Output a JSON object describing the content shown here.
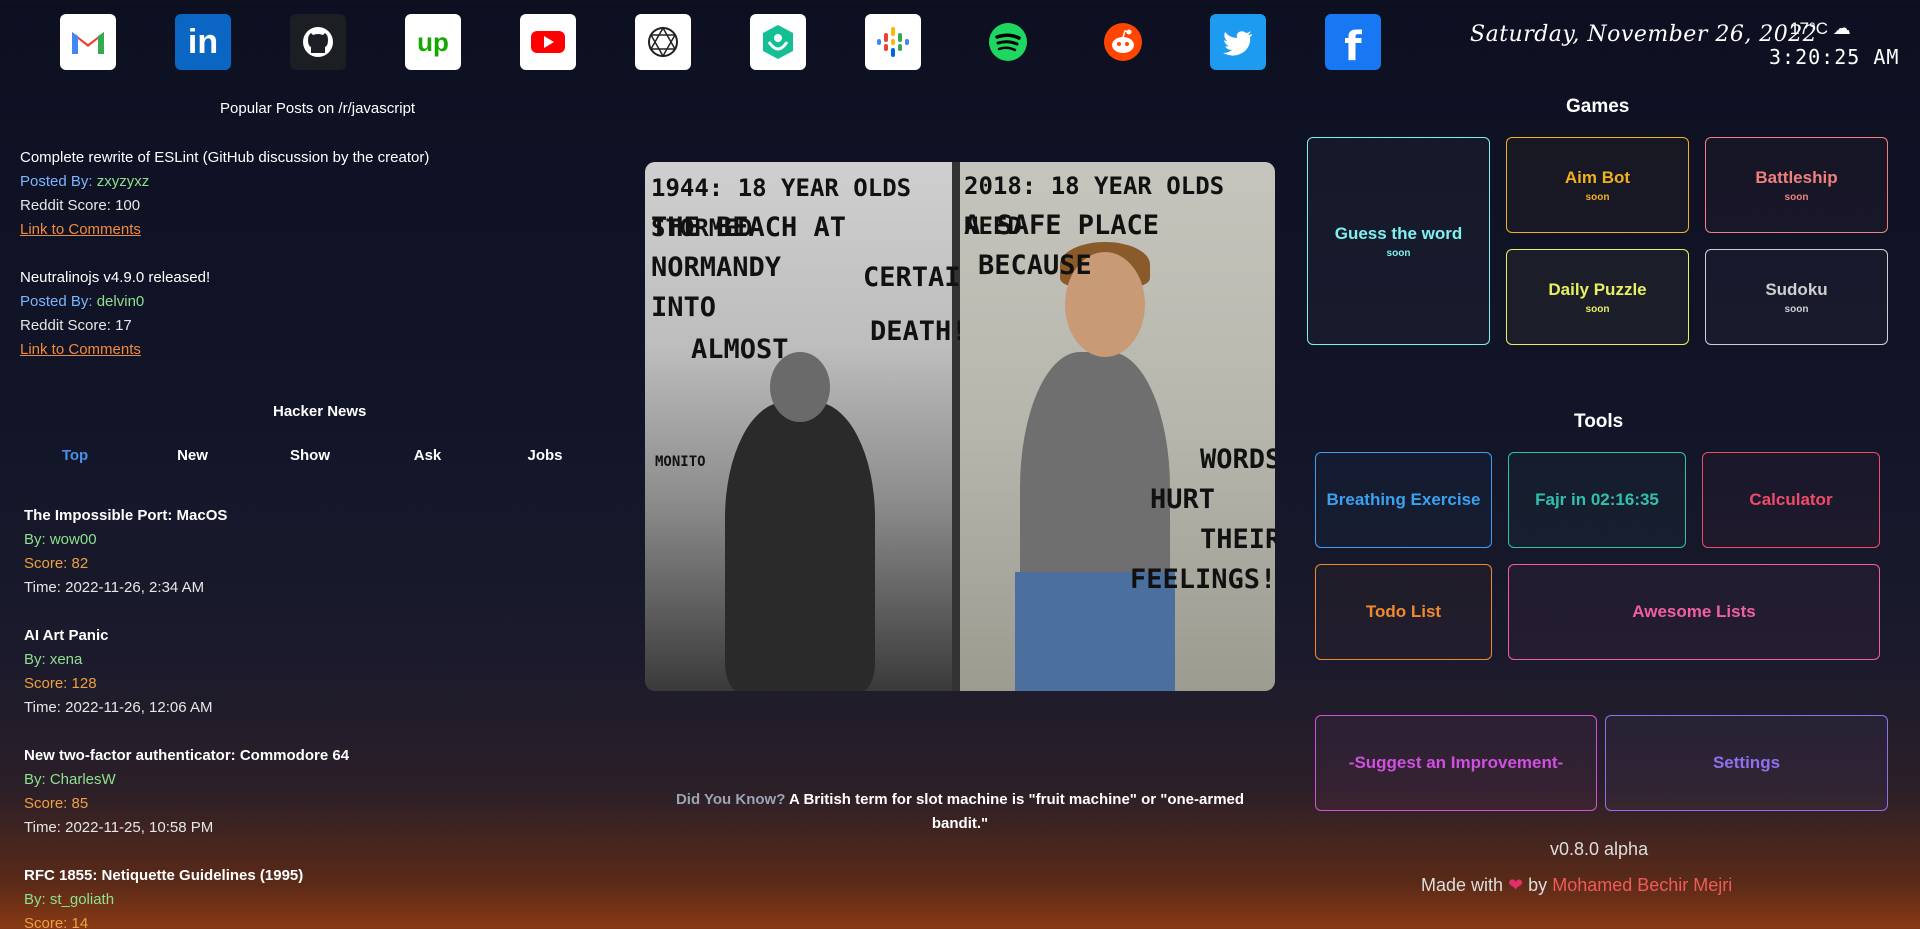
{
  "apps": [
    {
      "name": "gmail",
      "icon": "gmail-icon"
    },
    {
      "name": "linkedin",
      "icon": "linkedin-icon",
      "glyph": "in"
    },
    {
      "name": "github",
      "icon": "github-icon"
    },
    {
      "name": "upwork",
      "icon": "upwork-icon",
      "glyph": "up"
    },
    {
      "name": "youtube",
      "icon": "youtube-icon"
    },
    {
      "name": "openai",
      "icon": "openai-icon"
    },
    {
      "name": "khan-academy",
      "icon": "khan-academy-icon"
    },
    {
      "name": "google-podcasts",
      "icon": "google-podcasts-icon"
    },
    {
      "name": "spotify",
      "icon": "spotify-icon"
    },
    {
      "name": "reddit",
      "icon": "reddit-icon"
    },
    {
      "name": "twitter",
      "icon": "twitter-icon"
    },
    {
      "name": "facebook",
      "icon": "facebook-icon",
      "glyph": "f"
    }
  ],
  "header": {
    "date": "Saturday, November 26, 2022",
    "temperature": "17°C",
    "clock": "3:20:25 AM"
  },
  "reddit": {
    "title": "Popular Posts on /r/javascript",
    "posted_by_label": "Posted By:",
    "score_label": "Reddit Score:",
    "link_label": "Link to Comments",
    "posts": [
      {
        "title": "Complete rewrite of ESLint (GitHub discussion by the creator)",
        "author": "zxyzyxz",
        "score": "100"
      },
      {
        "title": "Neutralinojs v4.9.0 released!",
        "author": "delvin0",
        "score": "17"
      }
    ]
  },
  "hackernews": {
    "title": "Hacker News",
    "tabs": [
      "Top",
      "New",
      "Show",
      "Ask",
      "Jobs"
    ],
    "active_tab": "Top",
    "items": [
      {
        "title": "The Impossible Port: MacOS",
        "by": "By: wow00",
        "score": "Score: 82",
        "time": "Time: 2022-11-26, 2:34 AM"
      },
      {
        "title": "AI Art Panic",
        "by": "By: xena",
        "score": "Score: 128",
        "time": "Time: 2022-11-26, 12:06 AM"
      },
      {
        "title": "New two-factor authenticator: Commodore 64",
        "by": "By: CharlesW",
        "score": "Score: 85",
        "time": "Time: 2022-11-25, 10:58 PM"
      },
      {
        "title": "RFC 1855: Netiquette Guidelines (1995)",
        "by": "By: st_goliath",
        "score": "Score: 14",
        "time": ""
      }
    ]
  },
  "meme": {
    "left_lines": [
      "1944: 18 YEAR OLDS STORMED",
      "THE BEACH AT",
      "NORMANDY",
      "INTO",
      "ALMOST"
    ],
    "left_side": [
      "CERTAIN",
      "DEATH!"
    ],
    "left_credit": "MONITO",
    "right_lines": [
      "2018: 18 YEAR OLDS NEED",
      "A SAFE PLACE",
      "BECAUSE"
    ],
    "right_side": [
      "WORDS",
      "HURT",
      "THEIR",
      "FEELINGS!"
    ]
  },
  "did_you_know": {
    "label": "Did You Know?",
    "text": "A British term for slot machine is \"fruit machine\" or \"one-armed bandit.\""
  },
  "games": {
    "title": "Games",
    "soon": "soon",
    "items": [
      {
        "label": "Guess the word",
        "color": "#7ff0f0"
      },
      {
        "label": "Aim Bot",
        "color": "#f0b020"
      },
      {
        "label": "Battleship",
        "color": "#f08080"
      },
      {
        "label": "Daily Puzzle",
        "color": "#e8f060"
      },
      {
        "label": "Sudoku",
        "color": "#cfcfcf"
      }
    ]
  },
  "tools": {
    "title": "Tools",
    "items": [
      {
        "label": "Breathing Exercise",
        "color": "#3aa0f0"
      },
      {
        "label": "Fajr in 02:16:35",
        "color": "#30c0b0"
      },
      {
        "label": "Calculator",
        "color": "#f04a6a"
      },
      {
        "label": "Todo List",
        "color": "#f08a30"
      },
      {
        "label": "Awesome Lists",
        "color": "#f060a0"
      }
    ]
  },
  "footer": {
    "suggest": "-Suggest an Improvement-",
    "suggest_color": "#d050e0",
    "settings": "Settings",
    "settings_color": "#9070f0",
    "version": "v0.8.0 alpha",
    "made_with": "Made with",
    "by": "by",
    "author": "Mohamed Bechir Mejri"
  }
}
